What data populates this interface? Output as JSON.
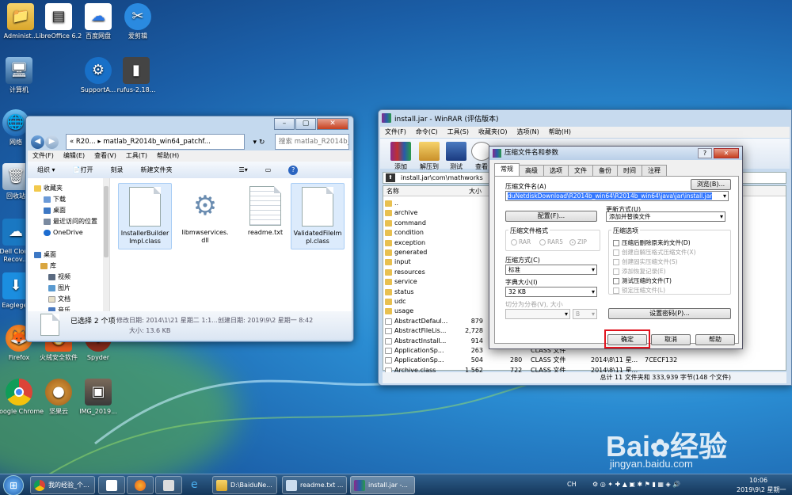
{
  "desktop": {
    "icons": [
      {
        "label": "Administ...",
        "icon": "folder-user-icon"
      },
      {
        "label": "LibreOffice 6.2",
        "icon": "libreoffice-icon"
      },
      {
        "label": "百度网盘",
        "icon": "baidu-netdisk-icon"
      },
      {
        "label": "爱剪辑",
        "icon": "video-editor-icon"
      },
      {
        "label": "计算机",
        "icon": "computer-icon"
      },
      {
        "label": "SupportA...",
        "icon": "support-assist-icon"
      },
      {
        "label": "rufus-2.18...",
        "icon": "usb-drive-icon"
      },
      {
        "label": "网络",
        "icon": "network-icon"
      },
      {
        "label": "回收站",
        "icon": "recycle-bin-icon"
      },
      {
        "label": "Dell Cloud Recov...",
        "icon": "dell-cloud-icon"
      },
      {
        "label": "Eagleget",
        "icon": "eagleget-icon"
      },
      {
        "label": "Firefox",
        "icon": "firefox-icon"
      },
      {
        "label": "火绒安全软件",
        "icon": "huorong-icon"
      },
      {
        "label": "Spyder",
        "icon": "spyder-icon"
      },
      {
        "label": "Google Chrome",
        "icon": "chrome-icon"
      },
      {
        "label": "坚果云",
        "icon": "jianguoyun-icon"
      },
      {
        "label": "IMG_2019...",
        "icon": "image-file-icon"
      }
    ],
    "watermark": {
      "brand": "Bai",
      "brand2": "经验",
      "url": "jingyan.baidu.com"
    }
  },
  "explorer": {
    "breadcrumb_short": "« R20...",
    "breadcrumb_current": "matlab_R2014b_win64_patchf...",
    "search_placeholder": "搜索 matlab_R2014b_win6...",
    "menu": [
      "文件(F)",
      "编辑(E)",
      "查看(V)",
      "工具(T)",
      "帮助(H)"
    ],
    "toolbar": {
      "organize": "组织",
      "open": "打开",
      "burn": "刻录",
      "new_folder": "新建文件夹"
    },
    "nav": [
      {
        "label": "收藏夹",
        "level": 0
      },
      {
        "label": "下载",
        "level": 1
      },
      {
        "label": "桌面",
        "level": 1
      },
      {
        "label": "最近访问的位置",
        "level": 1
      },
      {
        "label": "OneDrive",
        "level": 1
      },
      {
        "label": "",
        "level": 1
      },
      {
        "label": "桌面",
        "level": 0
      },
      {
        "label": "库",
        "level": 1
      },
      {
        "label": "视频",
        "level": 2
      },
      {
        "label": "图片",
        "level": 2
      },
      {
        "label": "文档",
        "level": 2
      },
      {
        "label": "音乐",
        "level": 2
      }
    ],
    "files": [
      {
        "name": "InstallerBuilderImpl.class",
        "selected": true
      },
      {
        "name": "libmwservices.dll",
        "selected": false
      },
      {
        "name": "readme.txt",
        "selected": false
      },
      {
        "name": "ValidatedFileImpl.class",
        "selected": true
      }
    ],
    "status": {
      "selection": "已选择 2 个项",
      "modified": "修改日期: 2014\\1\\21 星期二 1:1...",
      "created": "创建日期: 2019\\9\\2 星期一 8:42",
      "size": "大小: 13.6 KB"
    }
  },
  "winrar": {
    "title": "install.jar - WinRAR (评估版本)",
    "menu": [
      "文件(F)",
      "命令(C)",
      "工具(S)",
      "收藏夹(O)",
      "选项(N)",
      "帮助(H)"
    ],
    "toolbar": [
      "添加",
      "解压到",
      "测试",
      "查看"
    ],
    "path": "install.jar\\com\\mathworks",
    "columns": {
      "name": "名称",
      "size": "大小"
    },
    "rows": [
      {
        "name": "..",
        "size": "",
        "packed": "",
        "type": "",
        "modified": "",
        "crc": ""
      },
      {
        "name": "archive",
        "size": "",
        "packed": "",
        "type": "",
        "modified": "",
        "crc": ""
      },
      {
        "name": "command",
        "size": "",
        "packed": "",
        "type": "",
        "modified": "",
        "crc": ""
      },
      {
        "name": "condition",
        "size": "",
        "packed": "",
        "type": "",
        "modified": "",
        "crc": ""
      },
      {
        "name": "exception",
        "size": "",
        "packed": "",
        "type": "",
        "modified": "",
        "crc": ""
      },
      {
        "name": "generated",
        "size": "",
        "packed": "",
        "type": "",
        "modified": "",
        "crc": ""
      },
      {
        "name": "input",
        "size": "",
        "packed": "",
        "type": "",
        "modified": "",
        "crc": ""
      },
      {
        "name": "resources",
        "size": "",
        "packed": "",
        "type": "",
        "modified": "",
        "crc": ""
      },
      {
        "name": "service",
        "size": "",
        "packed": "",
        "type": "",
        "modified": "",
        "crc": ""
      },
      {
        "name": "status",
        "size": "",
        "packed": "",
        "type": "",
        "modified": "",
        "crc": ""
      },
      {
        "name": "udc",
        "size": "",
        "packed": "",
        "type": "",
        "modified": "",
        "crc": ""
      },
      {
        "name": "usage",
        "size": "",
        "packed": "",
        "type": "",
        "modified": "",
        "crc": ""
      },
      {
        "name": "AbstractDefaul...",
        "size": "879",
        "packed": "",
        "type": "",
        "modified": "",
        "crc": ""
      },
      {
        "name": "AbstractFileLis...",
        "size": "2,728",
        "packed": "",
        "type": "",
        "modified": "",
        "crc": ""
      },
      {
        "name": "AbstractInstall...",
        "size": "914",
        "packed": "",
        "type": "",
        "modified": "",
        "crc": ""
      },
      {
        "name": "ApplicationSp...",
        "size": "263",
        "packed": "",
        "type": "CLASS 文件",
        "modified": "",
        "crc": ""
      },
      {
        "name": "ApplicationSp...",
        "size": "504",
        "packed": "280",
        "type": "CLASS 文件",
        "modified": "2014\\8\\11 星...",
        "crc": "7CECF132"
      },
      {
        "name": "Archive.class",
        "size": "1,562",
        "packed": "722",
        "type": "CLASS 文件",
        "modified": "2014\\8\\11 星...",
        "crc": ""
      }
    ],
    "status_right": "总计 11 文件夹和 333,939 字节(148 个文件)"
  },
  "dialog": {
    "title": "压缩文件名和参数",
    "tabs": [
      "常规",
      "高级",
      "选项",
      "文件",
      "备份",
      "时间",
      "注释"
    ],
    "archive_name_label": "压缩文件名(A)",
    "archive_name_value": "duNetdiskDownload\\R2014b_win64\\R2014b_win64\\java\\jar\\install.jar",
    "browse": "浏览(B)...",
    "profiles": "配置(F)...",
    "update_mode_label": "更新方式(U)",
    "update_mode_value": "添加并替换文件",
    "format_label": "压缩文件格式",
    "formats": [
      "RAR",
      "RAR5",
      "ZIP"
    ],
    "method_label": "压缩方式(C)",
    "method_value": "标准",
    "dict_label": "字典大小(I)",
    "dict_value": "32 KB",
    "split_label": "切分为分卷(V), 大小",
    "split_unit": "B",
    "options_label": "压缩选项",
    "options": [
      {
        "label": "压缩后删除原来的文件(D)",
        "enabled": true
      },
      {
        "label": "创建自解压格式压缩文件(X)",
        "enabled": false
      },
      {
        "label": "创建固实压缩文件(S)",
        "enabled": false
      },
      {
        "label": "添加恢复记录(E)",
        "enabled": false
      },
      {
        "label": "测试压缩的文件(T)",
        "enabled": true
      },
      {
        "label": "锁定压缩文件(L)",
        "enabled": false
      }
    ],
    "password": "设置密码(P)...",
    "ok": "确定",
    "cancel": "取消",
    "help": "帮助",
    "highlight_color": "#e0141e"
  },
  "taskbar": {
    "tasks": [
      {
        "label": "我的经验_个...",
        "icon": "chrome-icon"
      },
      {
        "label": "",
        "icon": "baidu-netdisk-icon"
      },
      {
        "label": "",
        "icon": "firefox-icon"
      },
      {
        "label": "",
        "icon": "calculator-icon"
      },
      {
        "label": "",
        "icon": "ie-icon"
      },
      {
        "label": "D:\\BaiduNe...",
        "icon": "folder-icon"
      },
      {
        "label": "readme.txt ...",
        "icon": "notepad-icon"
      },
      {
        "label": "install.jar -...",
        "icon": "winrar-icon"
      }
    ],
    "tray_text": "CH",
    "time": "10:06",
    "date": "2019\\9\\2 星期一"
  }
}
